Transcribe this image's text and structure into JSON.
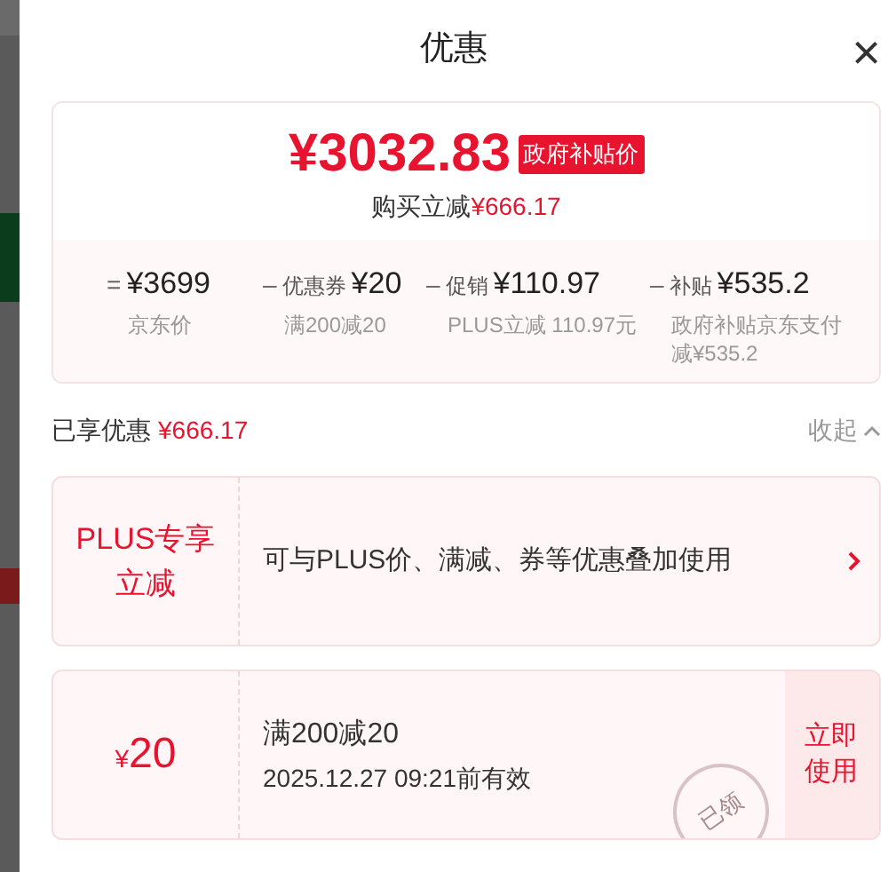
{
  "dialog": {
    "title": "优惠",
    "close": "×"
  },
  "summary": {
    "price": "¥3032.83",
    "badge": "政府补贴价",
    "saving_label": "购买立减",
    "saving_amount": "¥666.17",
    "breakdown": [
      {
        "op": "=",
        "amount": "¥3699",
        "note": "京东价"
      },
      {
        "op": "–",
        "label": "优惠券",
        "amount": "¥20",
        "note": "满200减20"
      },
      {
        "op": "–",
        "label": "促销",
        "amount": "¥110.97",
        "note": "PLUS立减 110.97元"
      },
      {
        "op": "–",
        "label": "补贴",
        "amount": "¥535.2",
        "note": "政府补贴京东支付减¥535.2"
      }
    ]
  },
  "section": {
    "label": "已享优惠",
    "amount": "¥666.17",
    "toggle": "收起",
    "expanded": true
  },
  "offers": [
    {
      "kind": "promo",
      "tag": "PLUS专享立减",
      "text": "可与PLUS价、满减、券等优惠叠加使用"
    },
    {
      "kind": "coupon",
      "currency": "¥",
      "value": "20",
      "title": "满200减20",
      "validity": "2025.12.27 09:21前有效",
      "action": "立即使用",
      "stamp": "已领"
    }
  ]
}
